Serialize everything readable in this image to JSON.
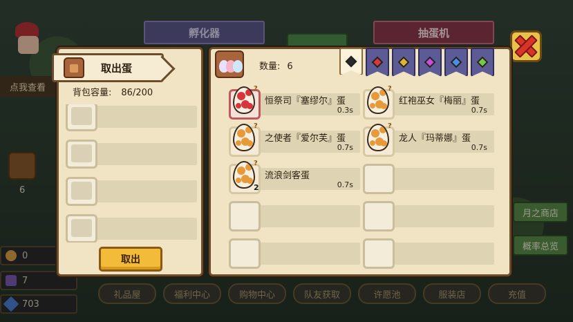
{
  "background": {
    "hatch_banner": "孵化器",
    "gacha_banner": "抽蛋机",
    "tap_to_view": "点我查看",
    "basket_count": "6",
    "resources": [
      {
        "icon": "coin-icon",
        "value": "0"
      },
      {
        "icon": "ticket-icon",
        "value": "7"
      },
      {
        "icon": "diamond-icon",
        "value": "703"
      }
    ],
    "bottom_tabs": [
      "礼品屋",
      "福利中心",
      "购物中心",
      "队友获取",
      "许愿池",
      "服装店",
      "充值"
    ],
    "side_buttons": [
      "月之商店",
      "概率总览"
    ]
  },
  "left_panel": {
    "title": "取出蛋",
    "capacity_label": "背包容量:",
    "capacity_value": "86/200",
    "slot_count": 4,
    "take_button": "取出"
  },
  "right_panel": {
    "count_label": "数量:",
    "count_value": "6",
    "tabs": [
      {
        "gem_color": "#2a2a2a",
        "active": true
      },
      {
        "gem_color": "#d33a3a",
        "active": false
      },
      {
        "gem_color": "#e0b23a",
        "active": false
      },
      {
        "gem_color": "#c54fd8",
        "active": false
      },
      {
        "gem_color": "#4a8fe0",
        "active": false
      },
      {
        "gem_color": "#7ac943",
        "active": false
      }
    ],
    "eggs": [
      {
        "name": "恒祭司『塞缪尔』蛋",
        "time": "0.3s",
        "rarity": "rare",
        "spot_color": "#d8343a"
      },
      {
        "name": "红袍巫女『梅丽』蛋",
        "time": "0.7s",
        "rarity": "normal",
        "spot_color": "#e89a3a"
      },
      {
        "name": "之使者『爱尔芙』蛋",
        "time": "0.7s",
        "rarity": "normal",
        "spot_color": "#e89a3a"
      },
      {
        "name": "龙人『玛蒂娜』蛋",
        "time": "0.7s",
        "rarity": "normal",
        "spot_color": "#e89a3a"
      },
      {
        "name": "流浪剑客蛋",
        "time": "0.7s",
        "rarity": "normal",
        "spot_color": "#e89a3a",
        "stack": "2"
      }
    ],
    "empty_slots": 5
  },
  "colors": {
    "panel_bg": "#f0e4c4",
    "panel_border": "#6b4c2a",
    "button_yellow": "#f2bb3a",
    "close_red": "#d8342c"
  }
}
